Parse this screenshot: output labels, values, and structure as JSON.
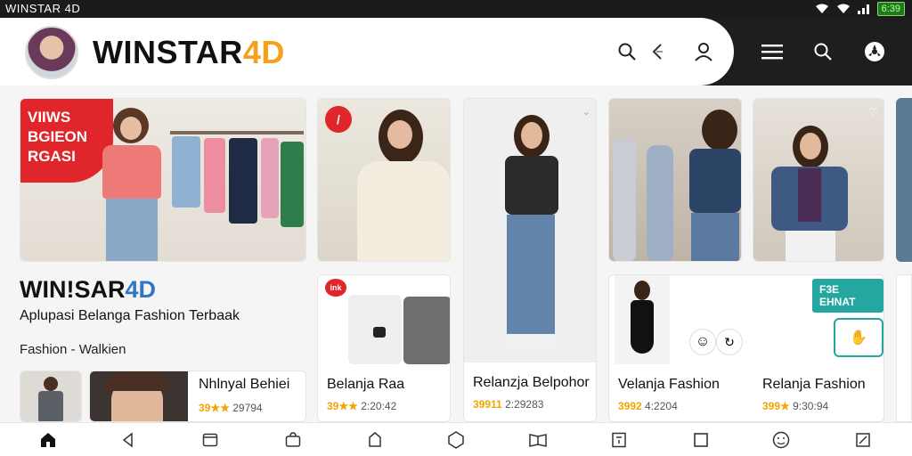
{
  "status": {
    "title": "WINSTAR 4D",
    "battery": "6:39"
  },
  "header": {
    "brand_main": "WINSTAR",
    "brand_accent": "4D"
  },
  "promo": {
    "badge_lines": [
      "VIIWS",
      "BGIEON",
      "RGASI"
    ],
    "brand_main": "WIN!SAR",
    "brand_accent": "4D",
    "tagline": "Aplupasi Belanga Fashion Terbaak",
    "subline": "Fashion - Walkien"
  },
  "products": [
    {
      "title": "Nhlnyal Behiei",
      "stars": "39★★",
      "rating": "29794"
    },
    {
      "title": "Belanja Raa",
      "stars": "39★★",
      "rating": "2:20:42"
    },
    {
      "title": "Relanzja Belpohor",
      "stars": "39911",
      "rating": "2:29283"
    },
    {
      "title": "Velanja Fashion",
      "stars": "3992",
      "rating": "4:2204"
    },
    {
      "title": "Relanja Fashion",
      "stars": "399★",
      "rating": "9:30:94"
    }
  ],
  "teal_button": "F3E EHNAT",
  "small_badge": "ink",
  "colors": {
    "accent": "#f4a11c",
    "red": "#e0262b",
    "teal": "#23a7a0",
    "dark": "#1e1e1e"
  },
  "icons": [
    "search-icon",
    "share-icon",
    "user-icon",
    "menu-icon",
    "search-icon",
    "settings-icon",
    "home-icon",
    "back-icon",
    "tab-icon",
    "bag-icon",
    "bookmark-icon",
    "circle-icon",
    "book-icon",
    "dialog-icon",
    "square-icon",
    "face-icon",
    "edit-icon"
  ]
}
